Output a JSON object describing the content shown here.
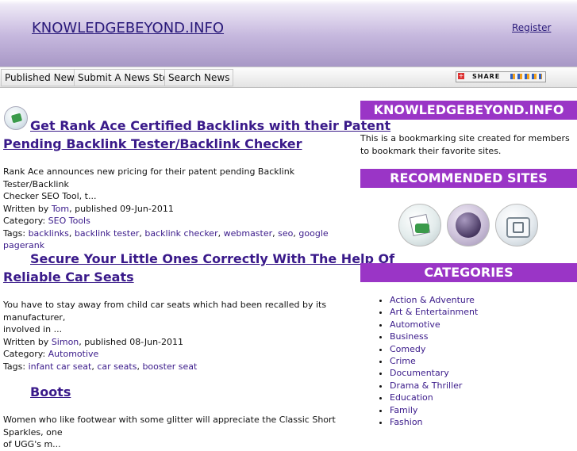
{
  "header": {
    "site_title": "KNOWLEDGEBEYOND.INFO",
    "register": "Register"
  },
  "nav": [
    "Published News",
    "Submit A News Story",
    "Search News"
  ],
  "share": {
    "label": "SHARE"
  },
  "posts": [
    {
      "title_line1": "Get Rank Ace Certified Backlinks with their Patent",
      "title_line2": "Pending Backlink Tester/Backlink Checker",
      "excerpt_line1": "Rank Ace announces new pricing for their patent pending Backlink Tester/Backlink",
      "excerpt_line2": "Checker SEO Tool, t...",
      "written_by": "Written by ",
      "author": "Tom",
      "published": ", published 09-Jun-2011",
      "category_label": "Category: ",
      "category": "SEO Tools",
      "tags_label": "Tags: ",
      "tags": [
        "backlinks",
        "backlink tester",
        "backlink checker",
        "webmaster",
        "seo",
        "google pagerank"
      ]
    },
    {
      "title_line1": "Secure Your Little Ones Correctly With The Help Of",
      "title_line2": "Reliable Car Seats",
      "excerpt_line1": "You have to stay away from child car seats which had been recalled by its manufacturer,",
      "excerpt_line2": "involved in ...",
      "written_by": "Written by ",
      "author": "Simon",
      "published": ", published 08-Jun-2011",
      "category_label": "Category: ",
      "category": "Automotive",
      "tags_label": "Tags: ",
      "tags": [
        "infant car seat",
        "car seats",
        "booster seat"
      ]
    },
    {
      "title_line1": "Boots",
      "excerpt_line1": "Women who like footwear with some glitter will appreciate the Classic Short Sparkles, one",
      "excerpt_line2": "of UGG's m..."
    }
  ],
  "sidebar": {
    "about_title": "KNOWLEDGEBEYOND.INFO",
    "about_text": "This is a bookmarking site created for members to bookmark their favorite sites.",
    "recommended_title": "RECOMMENDED SITES",
    "recommended_icons": [
      "cards-icon",
      "sphere-icon",
      "tv-icon"
    ],
    "categories_title": "CATEGORIES",
    "categories": [
      "Action & Adventure",
      "Art & Entertainment",
      "Automotive",
      "Business",
      "Comedy",
      "Crime",
      "Documentary",
      "Drama & Thriller",
      "Education",
      "Family",
      "Fashion"
    ]
  },
  "colors": {
    "accent": "#9a35c6",
    "link": "#3a1a8a"
  }
}
